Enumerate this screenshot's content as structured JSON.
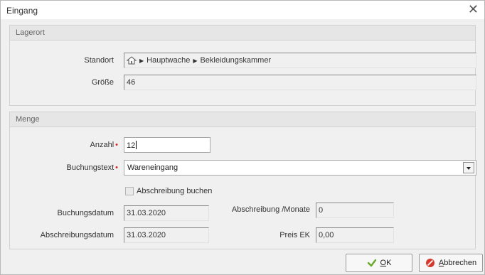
{
  "window": {
    "title": "Eingang"
  },
  "lagerort": {
    "header": "Lagerort",
    "standort_label": "Standort",
    "standort_path": [
      "Hauptwache",
      "Bekleidungskammer"
    ],
    "groesse_label": "Größe",
    "groesse_value": "46"
  },
  "menge": {
    "header": "Menge",
    "anzahl_label": "Anzahl",
    "anzahl_value": "12",
    "buchungstext_label": "Buchungstext",
    "buchungstext_value": "Wareneingang",
    "abschreibung_check_label": "Abschreibung buchen",
    "buchungsdatum_label": "Buchungsdatum",
    "buchungsdatum_value": "31.03.2020",
    "abschreibungsdatum_label": "Abschreibungsdatum",
    "abschreibungsdatum_value": "31.03.2020",
    "abschreibung_monate_label": "Abschreibung /Monate",
    "abschreibung_monate_value": "0",
    "preis_ek_label": "Preis EK",
    "preis_ek_value": "0,00"
  },
  "buttons": {
    "ok": "OK",
    "cancel": "Abbrechen"
  },
  "icons": {
    "close": "close-icon",
    "home": "home-icon",
    "check": "check-icon",
    "cancel": "cancel-icon"
  },
  "colors": {
    "required": "#dd2222",
    "ok_check": "#6aaa2a",
    "cancel_red": "#d63a2f"
  }
}
